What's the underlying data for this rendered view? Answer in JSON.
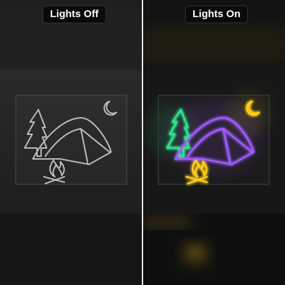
{
  "labels": {
    "off": "Lights Off",
    "on": "Lights On"
  },
  "colors": {
    "tree": "#2ee88a",
    "tent": "#a05cff",
    "moon": "#ffcc1a",
    "fire": "#ffcc1a",
    "unlit_tube": "#d8d8d8"
  },
  "icons": [
    "tree-icon",
    "tent-icon",
    "moon-icon",
    "campfire-icon"
  ]
}
